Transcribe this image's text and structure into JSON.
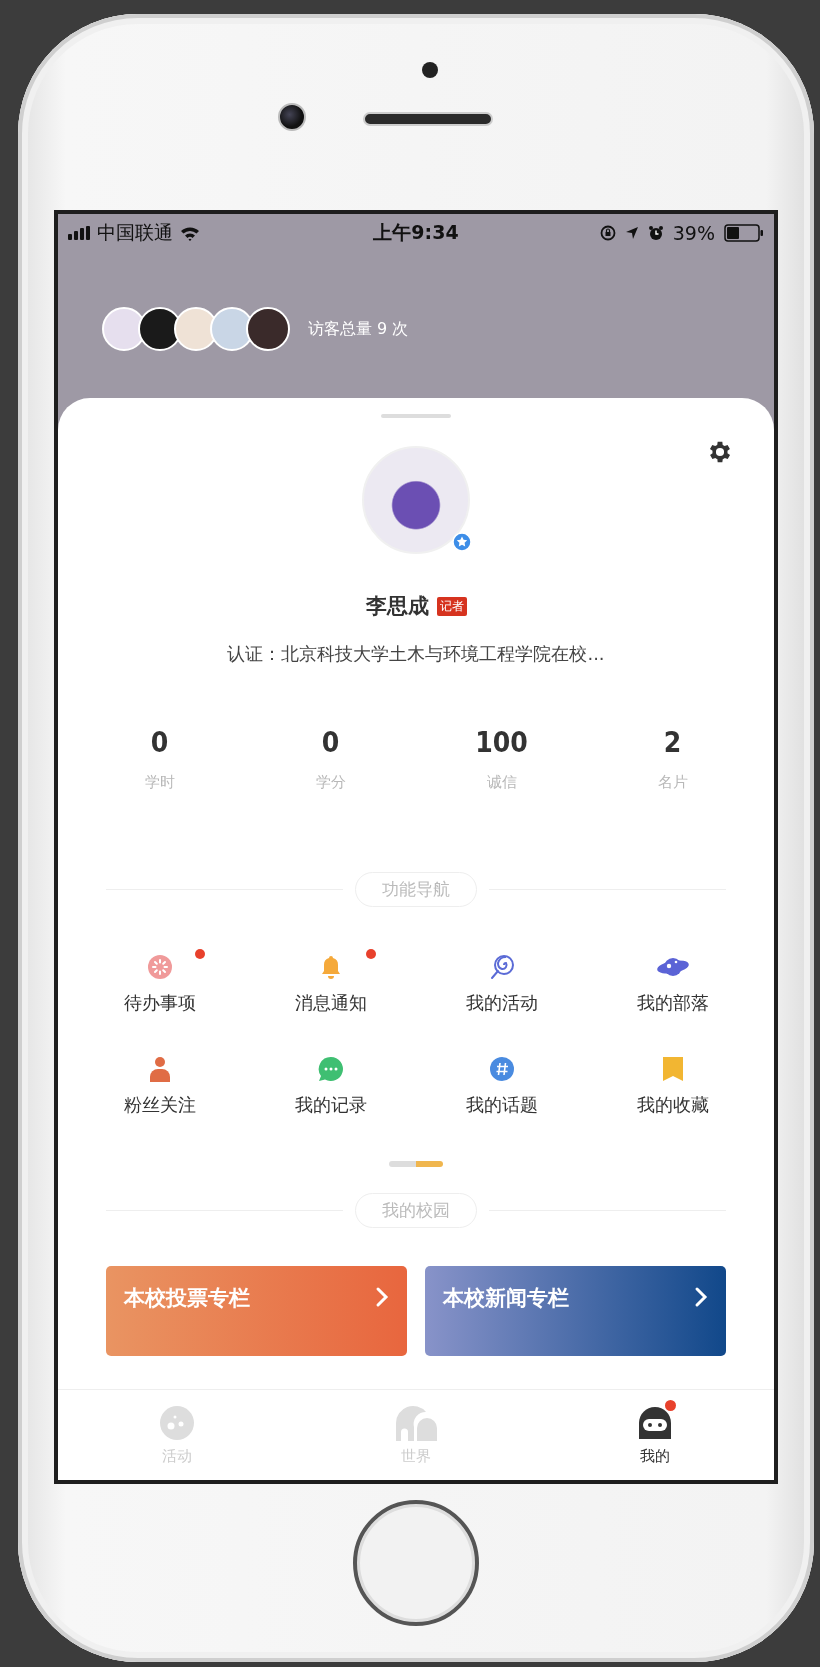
{
  "status_bar": {
    "carrier": "中国联通",
    "time": "上午9:34",
    "battery": "39%"
  },
  "visitors": {
    "label": "访客总量 9 次"
  },
  "profile": {
    "name": "李思成",
    "badge": "记者",
    "verified": true,
    "certification": "认证：北京科技大学土木与环境工程学院在校..."
  },
  "stats": [
    {
      "value": "0",
      "label": "学时"
    },
    {
      "value": "0",
      "label": "学分"
    },
    {
      "value": "100",
      "label": "诚信"
    },
    {
      "value": "2",
      "label": "名片"
    }
  ],
  "nav": {
    "title": "功能导航",
    "items": [
      {
        "label": "待办事项",
        "unread": true
      },
      {
        "label": "消息通知",
        "unread": true
      },
      {
        "label": "我的活动",
        "unread": false
      },
      {
        "label": "我的部落",
        "unread": false
      },
      {
        "label": "粉丝关注",
        "unread": false
      },
      {
        "label": "我的记录",
        "unread": false
      },
      {
        "label": "我的话题",
        "unread": false
      },
      {
        "label": "我的收藏",
        "unread": false
      }
    ]
  },
  "pager": [
    {
      "selected": false
    },
    {
      "selected": true
    }
  ],
  "campus": {
    "title": "我的校园",
    "banners": [
      {
        "label": "本校投票专栏"
      },
      {
        "label": "本校新闻专栏"
      }
    ]
  },
  "tabbar": [
    {
      "label": "活动",
      "selected": false,
      "badge": false
    },
    {
      "label": "世界",
      "selected": false,
      "badge": false
    },
    {
      "label": "我的",
      "selected": true,
      "badge": true
    }
  ]
}
